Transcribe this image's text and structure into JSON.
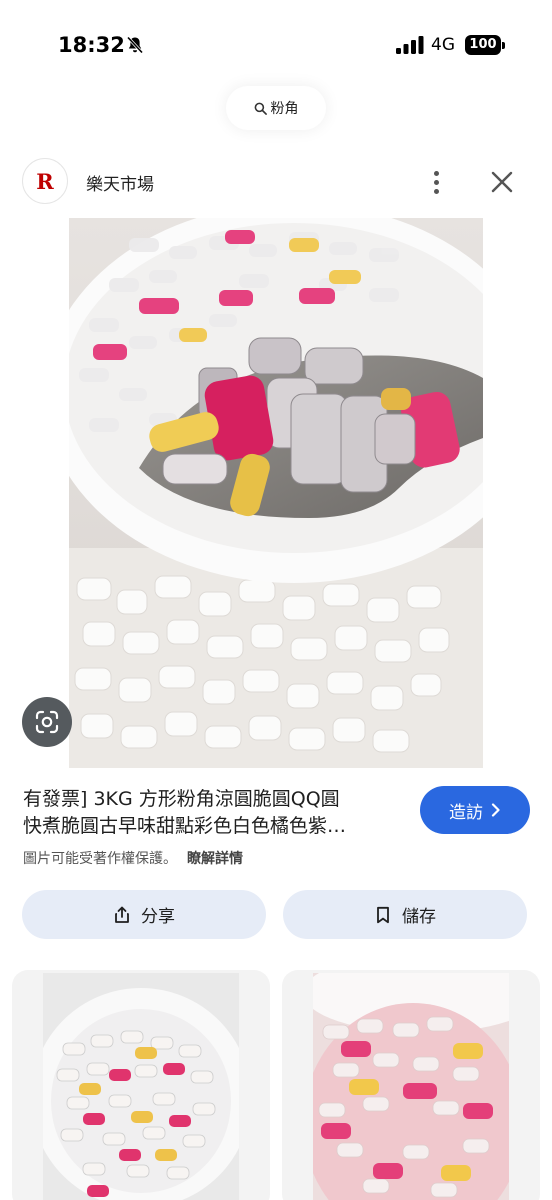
{
  "status_bar": {
    "time": "18:32",
    "network": "4G",
    "battery": "100"
  },
  "search": {
    "query": "粉角",
    "icon": "search-icon"
  },
  "source": {
    "logo_letter": "R",
    "name": "樂天市場",
    "brand_color": "#bf0000"
  },
  "result": {
    "title_line1": "有發票] 3KG 方形粉角涼圓脆圓QQ圓",
    "title_line2": "快煮脆圓古早味甜點彩色白色橘色紫…",
    "visit_label": "造訪",
    "copyright_text": "圖片可能受著作權保護。",
    "learn_more": "瞭解詳情"
  },
  "actions": {
    "share_label": "分享",
    "save_label": "儲存"
  },
  "colors": {
    "accent": "#2a68e0",
    "action_bg": "#e6ecf7"
  }
}
